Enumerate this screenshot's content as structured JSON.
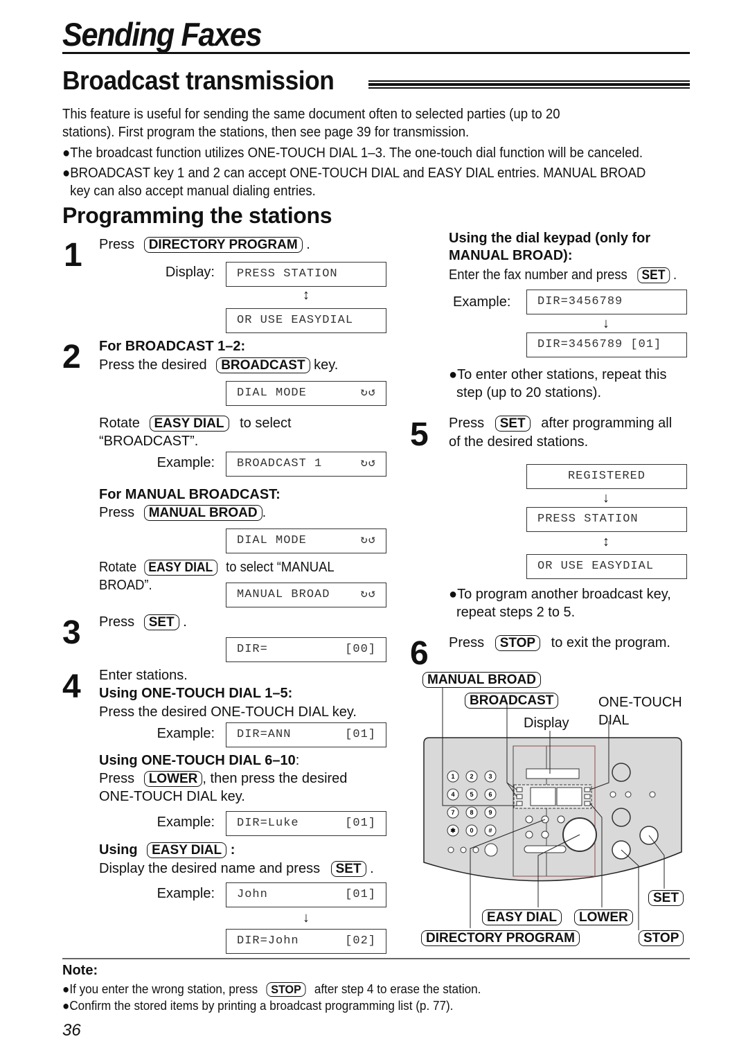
{
  "header": {
    "chapter_title": "Sending Faxes",
    "section_title": "Broadcast transmission"
  },
  "intro": {
    "paragraph": "This feature is useful for sending the same document often to selected parties (up to 20 stations). First program the stations, then see page 39 for transmission.",
    "paragraph_line1": "This feature is useful for sending the same document often to selected parties (up to 20",
    "paragraph_line2": "stations). First program the stations, then see page 39 for transmission.",
    "bullet1": "●The broadcast function utilizes ONE-TOUCH DIAL 1–3. The one-touch dial function will be canceled.",
    "bullet2_line1": "●BROADCAST key 1 and 2 can accept ONE-TOUCH DIAL and EASY DIAL entries. MANUAL BROAD",
    "bullet2_line2": "key can also accept manual dialing entries."
  },
  "programming": {
    "title": "Programming the stations",
    "step1": {
      "num": "1",
      "press": "Press",
      "key": "DIRECTORY PROGRAM",
      "period": ".",
      "display_label": "Display:",
      "lcd1": "PRESS STATION",
      "lcd2": "OR USE EASYDIAL"
    },
    "step2": {
      "num": "2",
      "heading": "For BROADCAST 1–2:",
      "press_text": "Press the desired",
      "key": "BROADCAST",
      "after_key": "key.",
      "lcd_dial_mode": "DIAL MODE",
      "rotate": "Rotate",
      "rotate_key": "EASY DIAL",
      "to_select": "to select",
      "broadcast_quote": "“BROADCAST”.",
      "example_label": "Example:",
      "lcd_broadcast": "BROADCAST 1",
      "manual_heading": "For MANUAL BROADCAST:",
      "manual_press": "Press",
      "manual_key": "MANUAL BROAD",
      "manual_period": ".",
      "lcd_dial_mode2": "DIAL MODE",
      "rotate2": "Rotate",
      "rotate2_key": "EASY DIAL",
      "to_select_manual": "to select “MANUAL",
      "broad_quote": "BROAD”.",
      "lcd_manual": "MANUAL BROAD",
      "rotate_icon": "↻↺"
    },
    "step3": {
      "num": "3",
      "press": "Press",
      "key": "SET",
      "period": ".",
      "lcd_left": "DIR=",
      "lcd_right": "[00]"
    },
    "step4": {
      "num": "4",
      "enter": "Enter stations.",
      "heading_1_5": "Using ONE-TOUCH DIAL 1–5:",
      "press_desired": "Press the desired ONE-TOUCH DIAL key.",
      "example_label": "Example:",
      "lcd_ann_left": "DIR=ANN",
      "lcd_ann_right": "[01]",
      "heading_6_10_a": "Using ONE-TOUCH DIAL 6–10",
      "heading_6_10_b": ":",
      "press": "Press",
      "lower_key": "LOWER",
      "then_press": ", then press the desired",
      "one_touch_key": "ONE-TOUCH DIAL key.",
      "lcd_luke_left": "DIR=Luke",
      "lcd_luke_right": "[01]",
      "using": "Using",
      "easy_key": "EASY DIAL",
      "colon": ":",
      "display_desired": "Display the desired name and press",
      "set_key": "SET",
      "period": ".",
      "lcd_john_left": "John",
      "lcd_john_right": "[01]",
      "lcd_dirjohn_left": "DIR=John",
      "lcd_dirjohn_right": "[02]"
    },
    "keypad": {
      "heading_line1": "Using the dial keypad (only for",
      "heading_line2": "MANUAL BROAD):",
      "enter_text": "Enter the fax number and press",
      "set_key": "SET",
      "period": ".",
      "example_label": "Example:",
      "lcd1": "DIR=3456789",
      "lcd2": "DIR=3456789 [01]",
      "bullet_line1": "●To enter other stations, repeat this",
      "bullet_line2": "step (up to 20 stations)."
    },
    "step5": {
      "num": "5",
      "press": "Press",
      "key": "SET",
      "after": "after programming all",
      "line2": "of the desired stations.",
      "lcd1": "REGISTERED",
      "lcd2": "PRESS STATION",
      "lcd3": "OR USE EASYDIAL",
      "bullet_line1": "●To program another broadcast key,",
      "bullet_line2": "repeat steps 2 to 5."
    },
    "step6": {
      "num": "6",
      "press": "Press",
      "key": "STOP",
      "after": "to exit the program."
    }
  },
  "diagram": {
    "labels": {
      "manual_broad": "MANUAL BROAD",
      "broadcast": "BROADCAST",
      "one_touch_line1": "ONE-TOUCH",
      "one_touch_line2": "DIAL",
      "display": "Display",
      "set": "SET",
      "easy_dial": "EASY DIAL",
      "lower": "LOWER",
      "directory_program": "DIRECTORY PROGRAM",
      "stop": "STOP"
    },
    "keypad_keys": [
      "1",
      "2",
      "3",
      "4",
      "5",
      "6",
      "7",
      "8",
      "9",
      "✱",
      "0",
      "#"
    ],
    "panel_color": "#d9d9d9"
  },
  "note": {
    "title": "Note:",
    "line1_a": "●If you enter the wrong station, press",
    "line1_key": "STOP",
    "line1_b": "after step 4 to erase the station.",
    "line2": "●Confirm the stored items by printing a broadcast programming list (p. 77)."
  },
  "page_number": "36"
}
